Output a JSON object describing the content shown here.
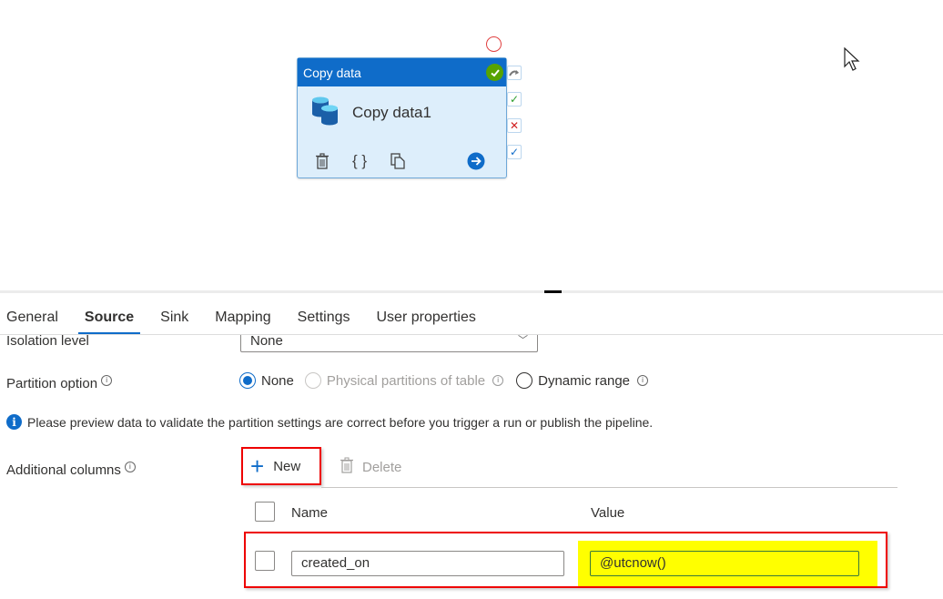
{
  "canvas": {
    "activity": {
      "type_label": "Copy data",
      "name": "Copy data1",
      "status": "succeeded",
      "icons": [
        "delete-icon",
        "code-braces-icon",
        "clone-icon",
        "go-arrow-icon"
      ],
      "connectors": [
        "skip",
        "success",
        "failure",
        "completion"
      ]
    }
  },
  "tabs": [
    {
      "label": "General",
      "active": false
    },
    {
      "label": "Source",
      "active": true
    },
    {
      "label": "Sink",
      "active": false
    },
    {
      "label": "Mapping",
      "active": false
    },
    {
      "label": "Settings",
      "active": false
    },
    {
      "label": "User properties",
      "active": false
    }
  ],
  "source": {
    "isolation_level": {
      "label": "Isolation level",
      "value": "None"
    },
    "partition_option": {
      "label": "Partition option",
      "options": [
        {
          "label": "None",
          "selected": true,
          "disabled": false
        },
        {
          "label": "Physical partitions of table",
          "selected": false,
          "disabled": true
        },
        {
          "label": "Dynamic range",
          "selected": false,
          "disabled": false
        }
      ]
    },
    "notice": "Please preview data to validate the partition settings are correct before you trigger a run or publish the pipeline.",
    "additional_columns": {
      "label": "Additional columns",
      "new_label": "New",
      "delete_label": "Delete",
      "headers": {
        "name": "Name",
        "value": "Value"
      },
      "rows": [
        {
          "name": "created_on",
          "value": "@utcnow()"
        }
      ]
    }
  },
  "colors": {
    "accent": "#0f6cc9",
    "highlight_border": "#ee0000",
    "highlight_fill": "#ffff00",
    "success": "#57a300"
  }
}
